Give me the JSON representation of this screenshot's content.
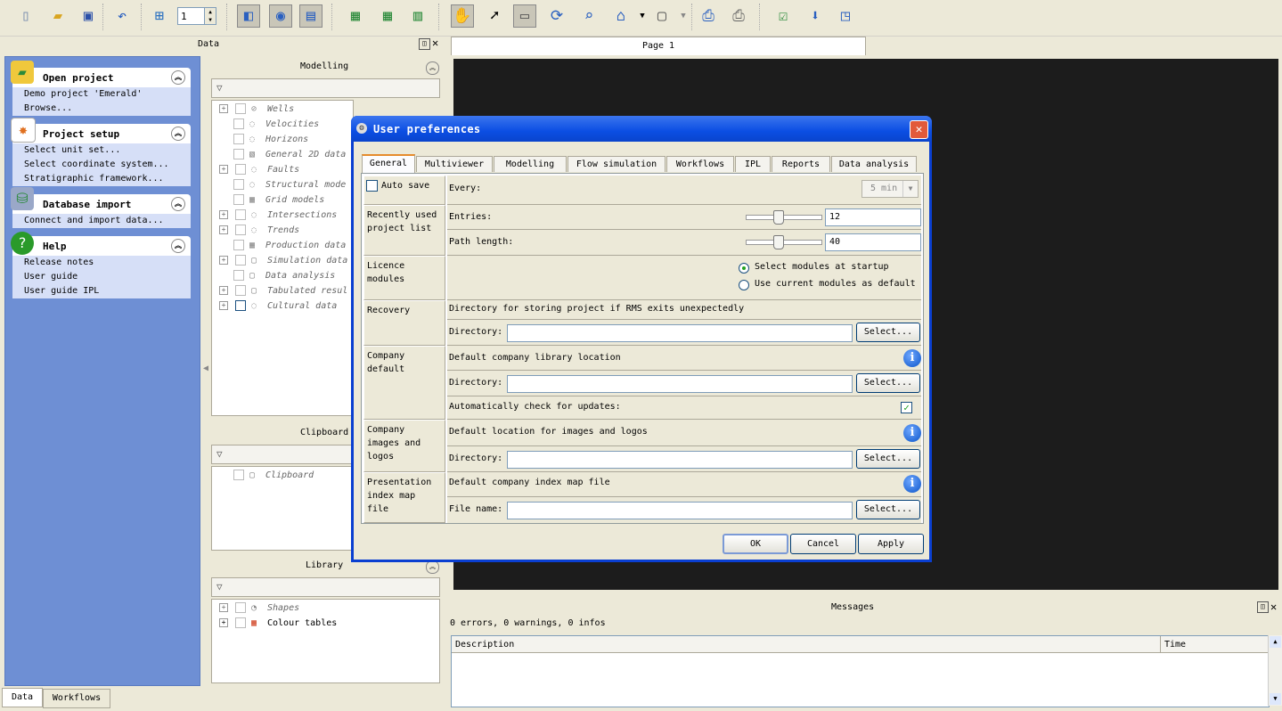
{
  "toolbar": {
    "spin_value": "1"
  },
  "left_panel": {
    "sections": [
      {
        "title": "Open project",
        "items": [
          "Demo project 'Emerald'",
          "Browse..."
        ]
      },
      {
        "title": "Project setup",
        "items": [
          "Select unit set...",
          "Select coordinate system...",
          "Stratigraphic framework..."
        ]
      },
      {
        "title": "Database import",
        "items": [
          "Connect and import data..."
        ]
      },
      {
        "title": "Help",
        "items": [
          "Release notes",
          "User guide",
          "User guide IPL"
        ]
      }
    ]
  },
  "data_panel": {
    "header": "Data",
    "modelling_title": "Modelling",
    "modelling_items": [
      "Wells",
      "Velocities",
      "Horizons",
      "General 2D data",
      "Faults",
      "Structural mode",
      "Grid models",
      "Intersections",
      "Trends",
      "Production data",
      "Simulation data",
      "Data analysis",
      "Tabulated resul",
      "Cultural data"
    ],
    "clipboard_title": "Clipboard",
    "clipboard_items": [
      "Clipboard"
    ],
    "library_title": "Library",
    "library_items": [
      "Shapes",
      "Colour tables"
    ]
  },
  "page_tab": "Page 1",
  "messages": {
    "title": "Messages",
    "summary": "0 errors, 0 warnings, 0 infos",
    "col_description": "Description",
    "col_time": "Time"
  },
  "bottom_tabs": [
    "Data",
    "Workflows"
  ],
  "dialog": {
    "title": "User preferences",
    "tabs": [
      "General",
      "Multiviewer",
      "Modelling",
      "Flow simulation",
      "Workflows",
      "IPL",
      "Reports",
      "Data analysis"
    ],
    "autosave_label": "Auto save",
    "every_label": "Every:",
    "every_value": "5 min",
    "recent_label": "Recently used project list",
    "entries_label": "Entries:",
    "entries_value": "12",
    "entries_fraction": 0.4,
    "path_label": "Path length:",
    "path_value": "40",
    "path_fraction": 0.4,
    "licence_label": "Licence modules",
    "radio_select": "Select modules at startup",
    "radio_current": "Use current modules as default",
    "recovery_label": "Recovery",
    "recovery_desc": "Directory for storing project if RMS exits unexpectedly",
    "directory_label": "Directory:",
    "select_button": "Select...",
    "company_label": "Company default",
    "company_desc": "Default company library location",
    "auto_check_label": "Automatically check for updates:",
    "images_label": "Company images and logos",
    "images_desc": "Default location for images and logos",
    "presentation_label": "Presentation index map file",
    "presentation_desc": "Default company index map file",
    "filename_label": "File name:",
    "ok": "OK",
    "cancel": "Cancel",
    "apply": "Apply"
  }
}
